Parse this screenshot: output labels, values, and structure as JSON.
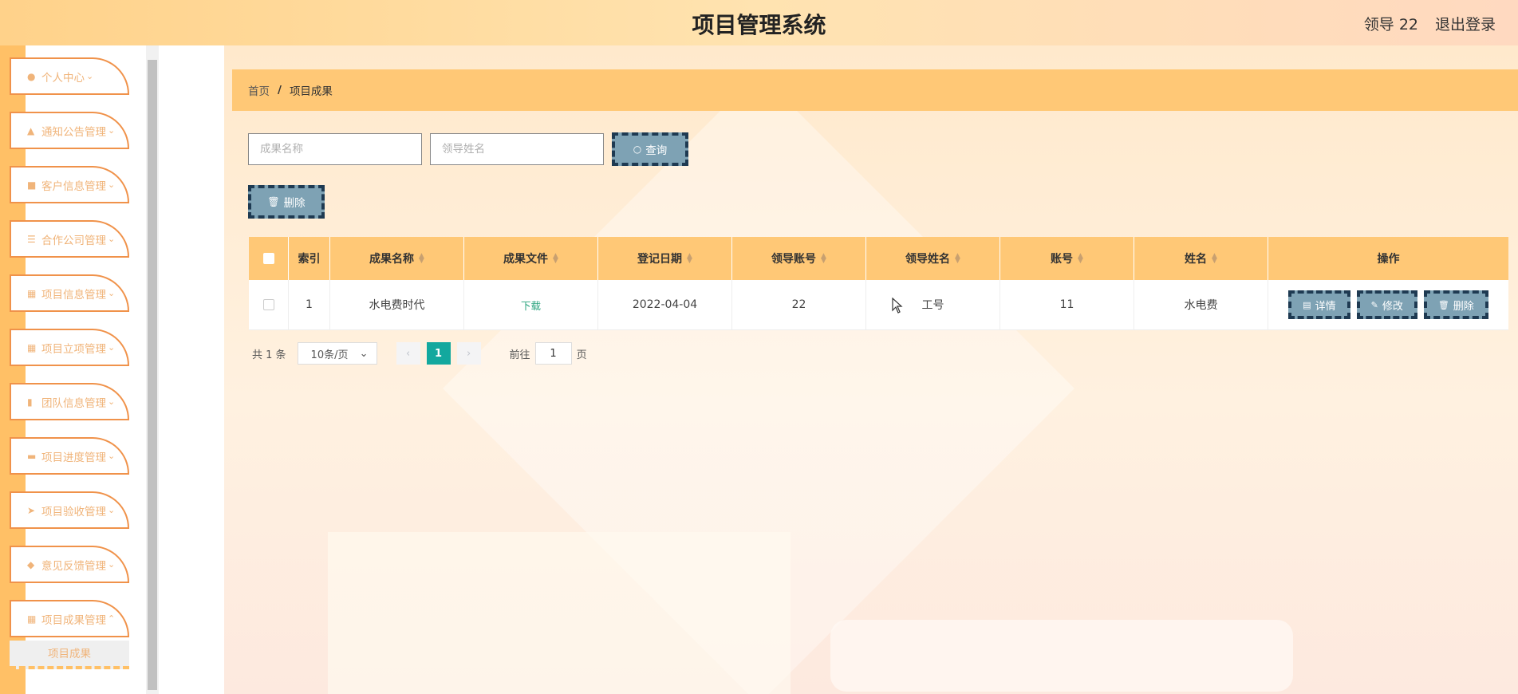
{
  "header": {
    "title": "项目管理系统",
    "user": "领导 22",
    "logout": "退出登录"
  },
  "sidebar": {
    "items": [
      {
        "label": "个人中心",
        "icon": "user-icon"
      },
      {
        "label": "通知公告管理",
        "icon": "thumb-icon"
      },
      {
        "label": "客户信息管理",
        "icon": "tag-icon"
      },
      {
        "label": "合作公司管理",
        "icon": "sliders-icon"
      },
      {
        "label": "项目信息管理",
        "icon": "grid-icon"
      },
      {
        "label": "项目立项管理",
        "icon": "grid-icon"
      },
      {
        "label": "团队信息管理",
        "icon": "chart-icon"
      },
      {
        "label": "项目进度管理",
        "icon": "comment-icon"
      },
      {
        "label": "项目验收管理",
        "icon": "send-icon"
      },
      {
        "label": "意见反馈管理",
        "icon": "ticket-icon"
      },
      {
        "label": "项目成果管理",
        "icon": "grid-icon"
      }
    ],
    "submenu_label": "项目成果"
  },
  "breadcrumb": {
    "home": "首页",
    "separator": "/",
    "current": "项目成果"
  },
  "search": {
    "name_placeholder": "成果名称",
    "leader_placeholder": "领导姓名",
    "query_label": "查询",
    "delete_label": "删除"
  },
  "table": {
    "headers": [
      "索引",
      "成果名称",
      "成果文件",
      "登记日期",
      "领导账号",
      "领导姓名",
      "账号",
      "姓名",
      "操作"
    ],
    "rows": [
      {
        "index": "1",
        "name": "水电费时代",
        "file": "下载",
        "date": "2022-04-04",
        "leader_account": "22",
        "leader_name": "工号",
        "account": "11",
        "person": "水电费"
      }
    ],
    "actions": {
      "detail": "详情",
      "edit": "修改",
      "delete": "删除"
    }
  },
  "pagination": {
    "total": "共 1 条",
    "page_size": "10条/页",
    "current_page": "1",
    "goto_prefix": "前往",
    "goto_value": "1",
    "goto_suffix": "页"
  },
  "colors": {
    "accent": "#ffc876",
    "button": "#7ea2b4",
    "button_border": "#1e3a52",
    "active_page": "#13a89e"
  }
}
